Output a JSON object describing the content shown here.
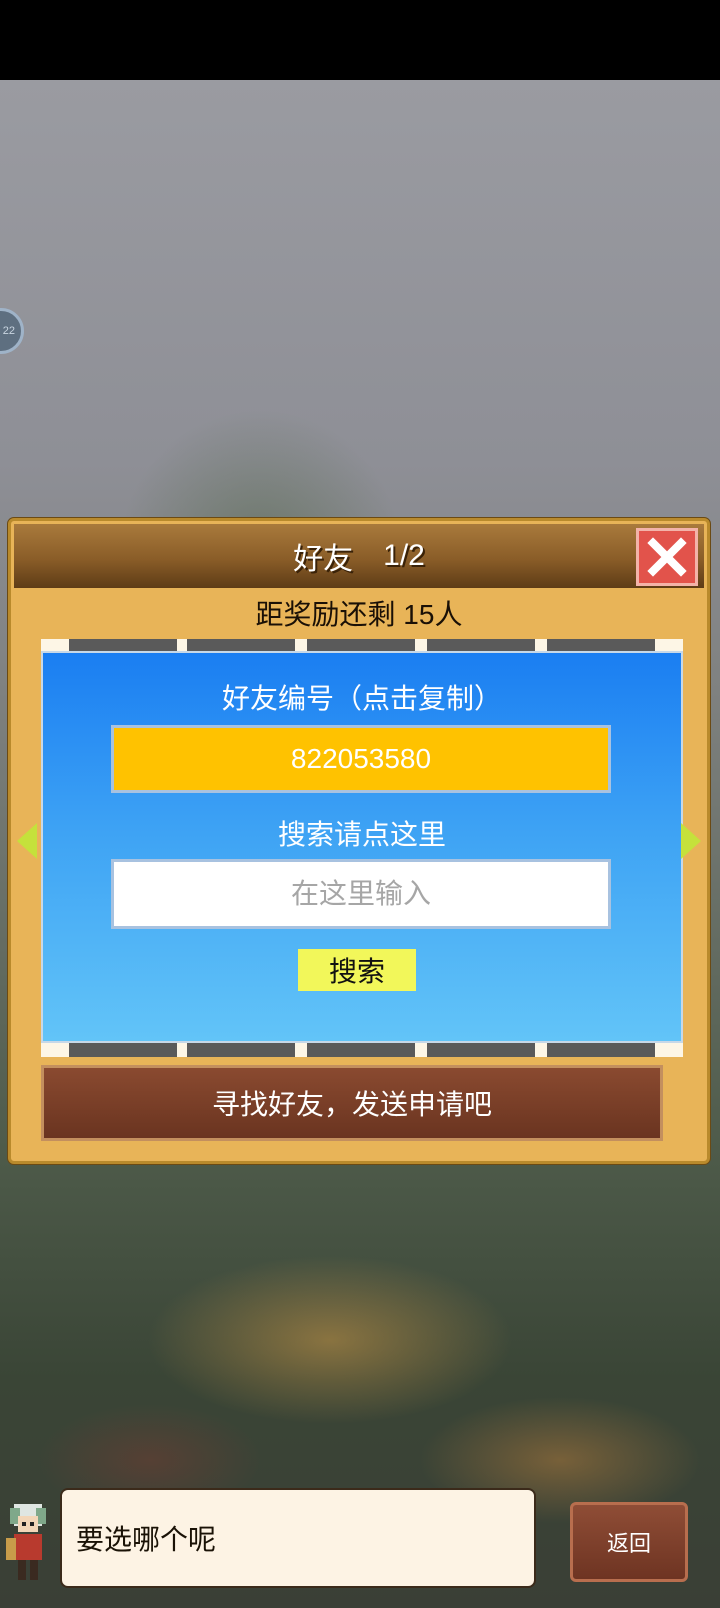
{
  "panel": {
    "title": "好友",
    "page_indicator": "1/2",
    "reward_text": "距奖励还剩 15人",
    "friend_id_label": "好友编号（点击复制）",
    "friend_id": "822053580",
    "search_label": "搜索请点这里",
    "search_placeholder": "在这里输入",
    "search_button": "搜索",
    "info_text": "寻找好友，发送申请吧"
  },
  "dialog": {
    "message": "要选哪个呢"
  },
  "back_button": "返回",
  "side_indicator": "22",
  "colors": {
    "panel_bg": "#e8b458",
    "title_bar": "#8a5d28",
    "blue_box": "#3da2f4",
    "id_field": "#ffc200",
    "search_button": "#f2f75a",
    "close_button": "#e2534b",
    "arrow": "#c5e13b"
  },
  "icons": [
    "close-icon",
    "arrow-left-icon",
    "arrow-right-icon",
    "character-avatar-icon"
  ]
}
